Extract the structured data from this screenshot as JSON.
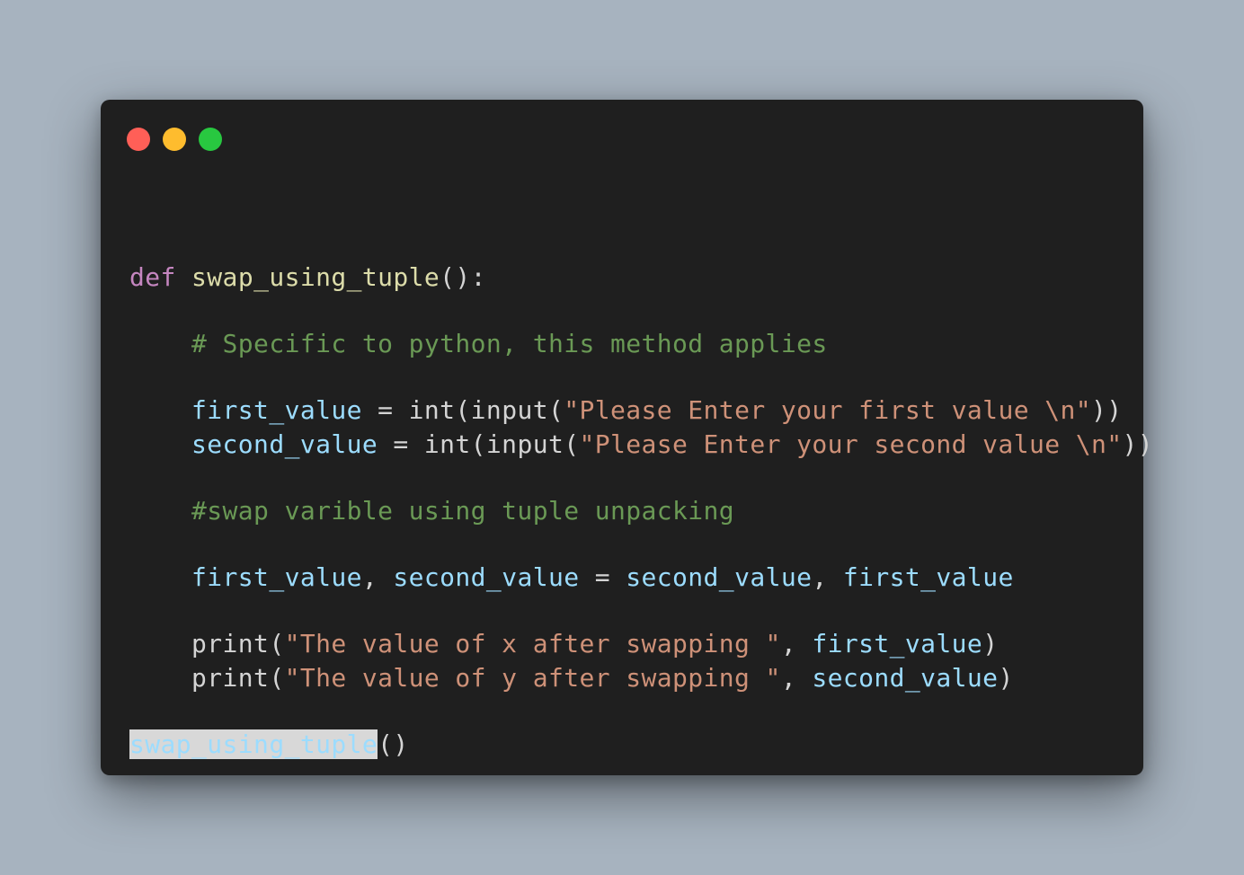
{
  "window": {
    "dot_colors": [
      "#ff5f57",
      "#febc2e",
      "#28c840"
    ]
  },
  "code": {
    "line1": {
      "kw": "def",
      "fn": "swap_using_tuple",
      "punct": "():"
    },
    "line2": {
      "comment": "# Specific to python, this method applies"
    },
    "line3": {
      "var": "first_value",
      "op": " = int(input(",
      "str": "\"Please Enter your first value \\n\"",
      "end": "))"
    },
    "line4": {
      "var": "second_value",
      "op": " = int(input(",
      "str": "\"Please Enter your second value \\n\"",
      "end": "))"
    },
    "line5": {
      "comment": "#swap varible using tuple unpacking"
    },
    "line6": {
      "var1": "first_value",
      "sep1": ", ",
      "var2": "second_value",
      "op": " = ",
      "var3": "second_value",
      "sep2": ", ",
      "var4": "first_value"
    },
    "line7": {
      "fn": "print(",
      "str": "\"The value of x after swapping \"",
      "sep": ", ",
      "var": "first_value",
      "end": ")"
    },
    "line8": {
      "fn": "print(",
      "str": "\"The value of y after swapping \"",
      "sep": ", ",
      "var": "second_value",
      "end": ")"
    },
    "line9": {
      "selected": "swap_using_tuple",
      "rest": "()"
    }
  }
}
